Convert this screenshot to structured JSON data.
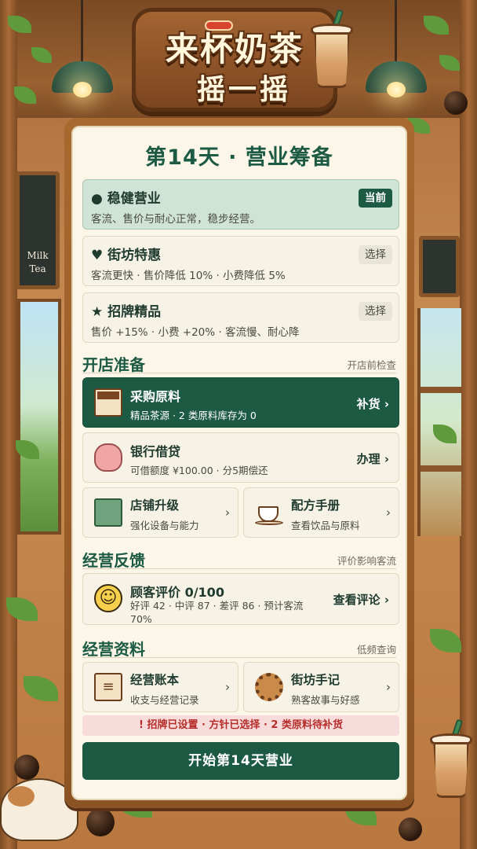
{
  "game": {
    "title_line1": "来杯奶茶",
    "title_line2": "摇一摇"
  },
  "day_title": "第14天 · 营业筹备",
  "strategies": [
    {
      "icon": "circle-icon",
      "glyph": "●",
      "name": "稳健营业",
      "desc": "客流、售价与耐心正常，稳步经营。",
      "tag": "当前",
      "current": true
    },
    {
      "icon": "heart-icon",
      "glyph": "♥",
      "name": "街坊特惠",
      "desc": "客流更快 · 售价降低 10% · 小费降低 5%",
      "tag": "选择",
      "current": false
    },
    {
      "icon": "star-icon",
      "glyph": "★",
      "name": "招牌精品",
      "desc": "售价 +15% · 小费 +20% · 客流慢、耐心降",
      "tag": "选择",
      "current": false
    }
  ],
  "prep": {
    "heading": "开店准备",
    "note": "开店前检查",
    "purchase": {
      "name": "采购原料",
      "desc": "精品茶源 · 2 类原料库存为 0",
      "action": "补货 ›",
      "icon": "supply-crate-icon"
    },
    "loan": {
      "name": "银行借贷",
      "desc": "可借额度 ¥100.00 · 分5期偿还",
      "action": "办理 ›",
      "icon": "piggy-bank-icon"
    },
    "upgrade": {
      "name": "店铺升级",
      "desc": "强化设备与能力",
      "chevron": "›",
      "icon": "machine-icon"
    },
    "recipes": {
      "name": "配方手册",
      "desc": "查看饮品与原料",
      "chevron": "›",
      "icon": "coffee-cup-icon"
    }
  },
  "feedback": {
    "heading": "经营反馈",
    "note": "评价影响客流",
    "review": {
      "name": "顾客评价 0/100",
      "desc": "好评 42 · 中评 87 · 差评 86 · 预计客流 70%",
      "action": "查看评论 ›",
      "icon": "smiley-face-icon"
    }
  },
  "records": {
    "heading": "经营资料",
    "note": "低频查询",
    "ledger": {
      "name": "经营账本",
      "desc": "收支与经营记录",
      "chevron": "›",
      "icon": "ledger-icon"
    },
    "notes": {
      "name": "街坊手记",
      "desc": "熟客故事与好感",
      "chevron": "›",
      "icon": "gear-icon"
    }
  },
  "alert_text": "! 招牌已设置 · 方针已选择 · 2 类原料待补货",
  "start_button": "开始第14天营业",
  "decor": {
    "chalkboard_text_line1": "Milk",
    "chalkboard_text_line2": "Tea"
  },
  "colors": {
    "primary": "#1d5a44",
    "current_bg": "#cfe3d6",
    "alert_bg": "#f8dcdb",
    "alert_text": "#b52d2a",
    "panel_bg": "#fbf6e8"
  }
}
